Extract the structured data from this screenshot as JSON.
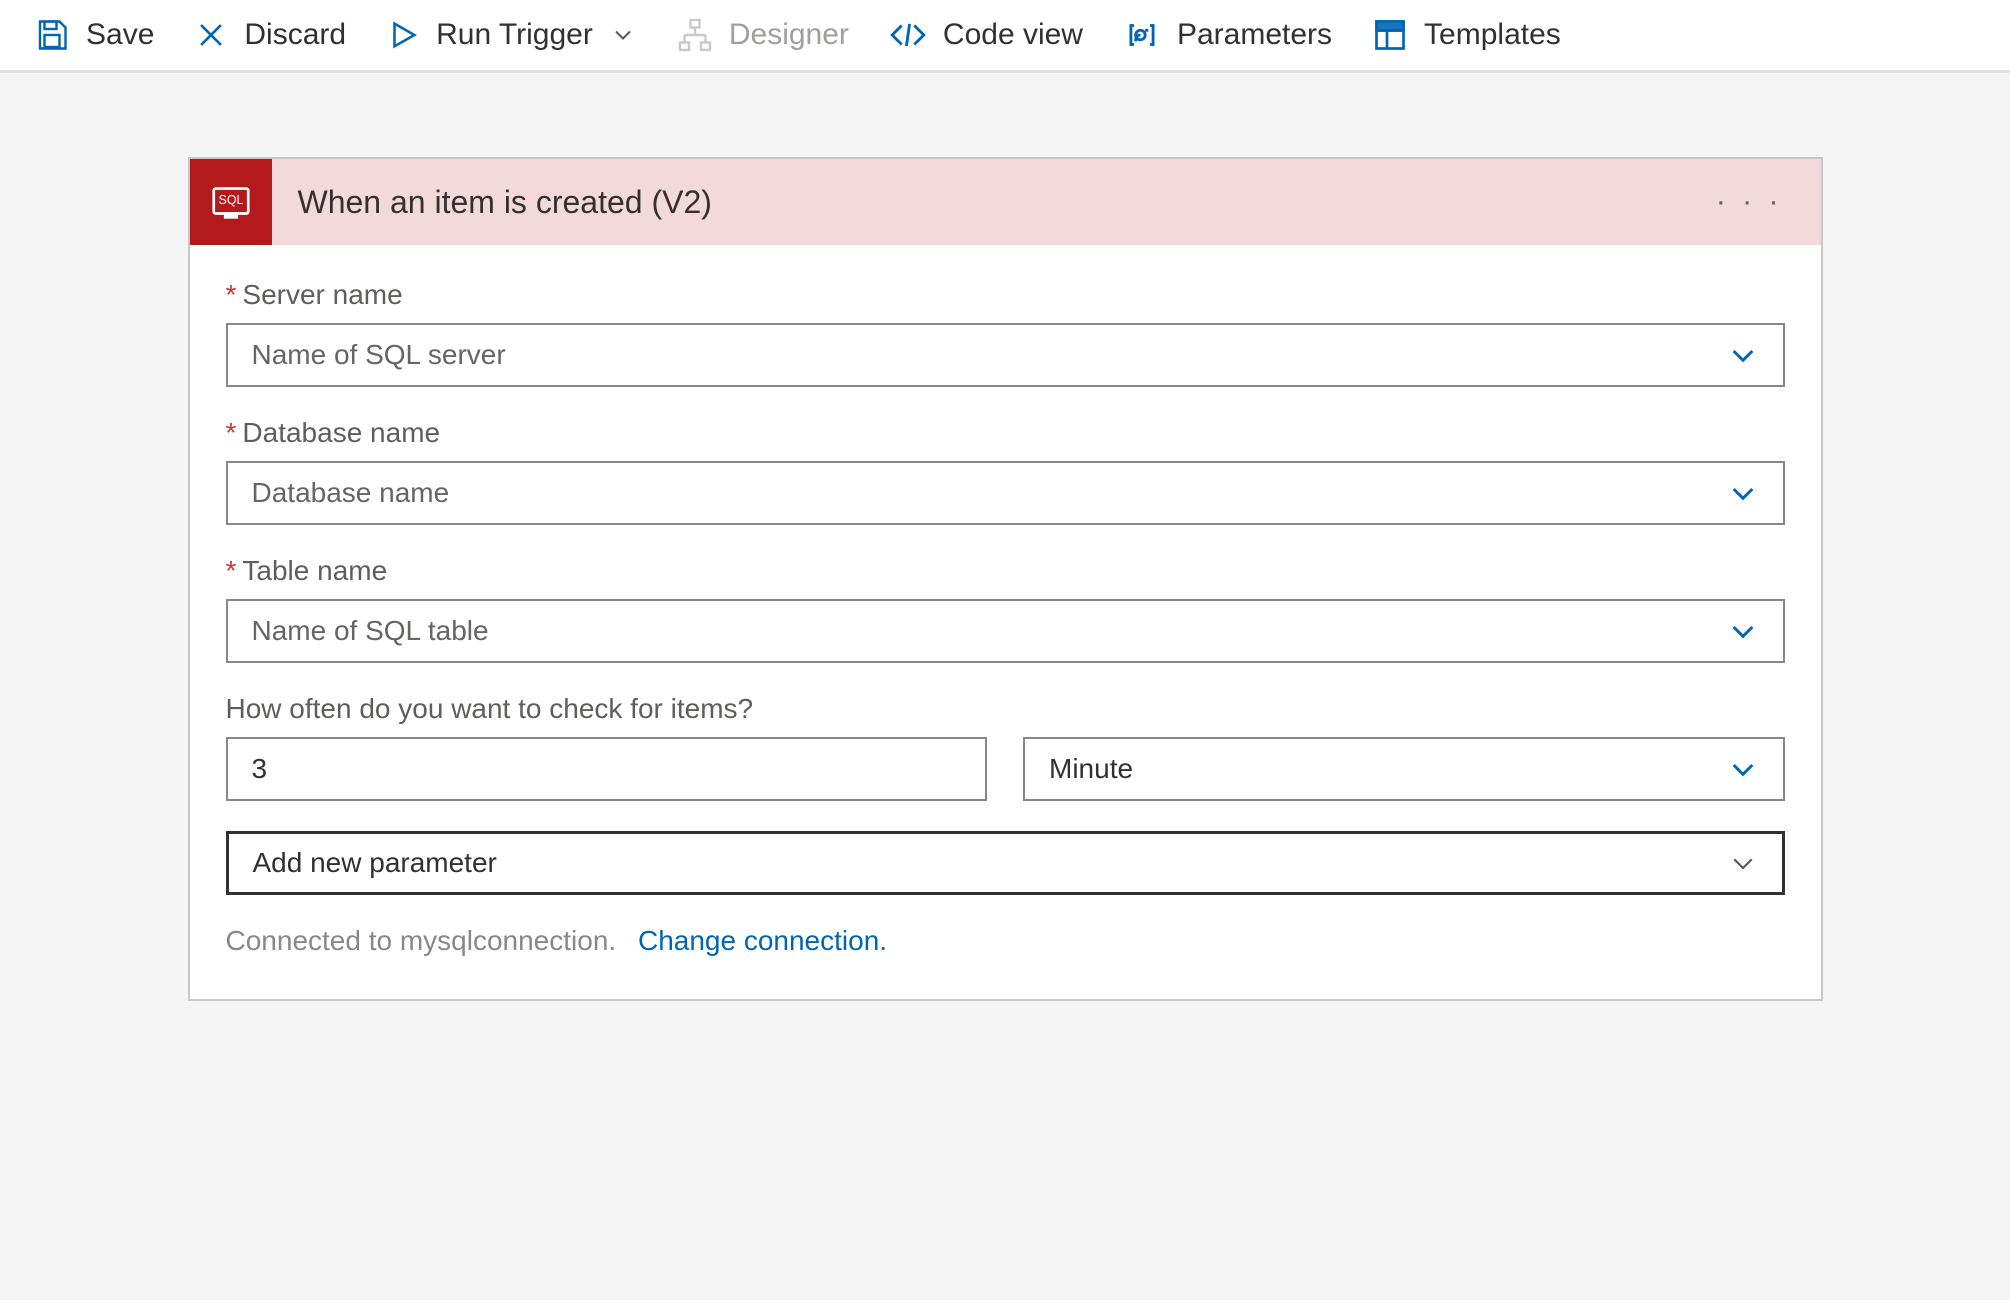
{
  "toolbar": {
    "save": "Save",
    "discard": "Discard",
    "run_trigger": "Run Trigger",
    "designer": "Designer",
    "code_view": "Code view",
    "parameters": "Parameters",
    "templates": "Templates"
  },
  "card": {
    "title": "When an item is created (V2)"
  },
  "fields": {
    "server_name": {
      "label": "Server name",
      "placeholder": "Name of SQL server"
    },
    "database_name": {
      "label": "Database name",
      "placeholder": "Database name"
    },
    "table_name": {
      "label": "Table name",
      "placeholder": "Name of SQL table"
    },
    "frequency_label": "How often do you want to check for items?",
    "interval_value": "3",
    "interval_unit": "Minute",
    "add_param": "Add new parameter"
  },
  "footer": {
    "connected_text": "Connected to mysqlconnection.",
    "change_link": "Change connection."
  }
}
